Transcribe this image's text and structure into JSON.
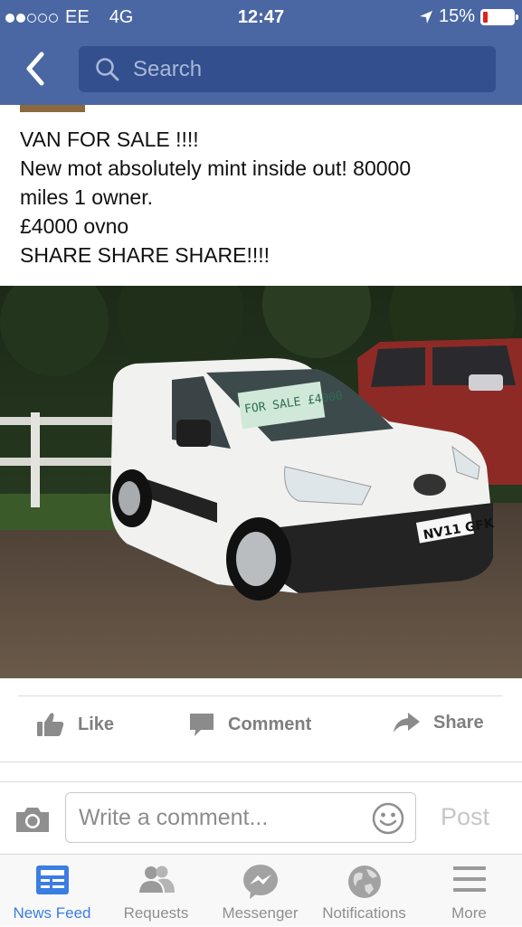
{
  "status_bar": {
    "carrier": "EE",
    "network": "4G",
    "time": "12:47",
    "battery": "15%",
    "battery_level": 0.15,
    "signal_bars": 2
  },
  "header": {
    "back_icon": "chevron-left-icon",
    "search_placeholder": "Search"
  },
  "post": {
    "lines": [
      "VAN FOR SALE !!!!",
      "New mot absolutely mint inside out! 80000",
      "miles 1 owner.",
      "£4000 ovno",
      "SHARE SHARE SHARE!!!!"
    ],
    "photo": {
      "windscreen_sign": "FOR SALE £4000",
      "number_plate": "NV11 GFK"
    }
  },
  "actions": {
    "like": "Like",
    "comment": "Comment",
    "share": "Share"
  },
  "comment_bar": {
    "placeholder": "Write a comment...",
    "post": "Post"
  },
  "tabs": [
    {
      "label": "News Feed",
      "icon": "news-feed-icon",
      "active": true
    },
    {
      "label": "Requests",
      "icon": "requests-icon",
      "active": false
    },
    {
      "label": "Messenger",
      "icon": "messenger-icon",
      "active": false
    },
    {
      "label": "Notifications",
      "icon": "globe-icon",
      "active": false
    },
    {
      "label": "More",
      "icon": "menu-icon",
      "active": false
    }
  ],
  "colors": {
    "header": "#4a67a4",
    "search_field": "#334f8d",
    "active_tab": "#3b7de3",
    "inactive": "#8f8f8f"
  }
}
